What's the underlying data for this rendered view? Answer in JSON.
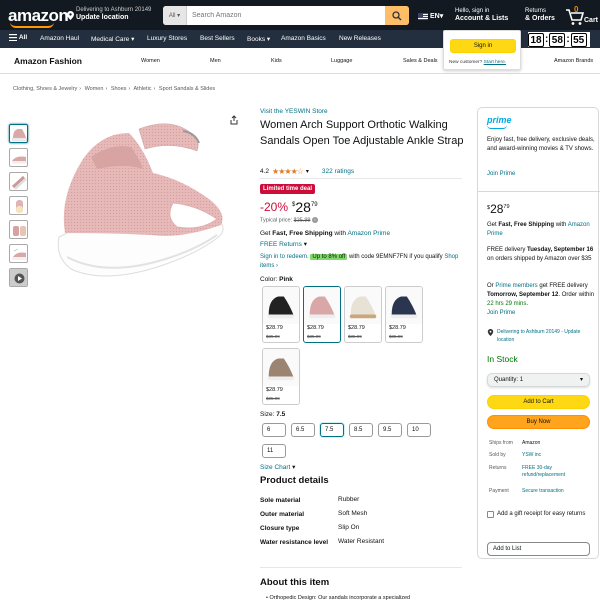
{
  "nav": {
    "logo": "amazon",
    "deliver_line1": "Delivering to Ashburn 20149",
    "deliver_line2": "Update location",
    "search_category": "All",
    "search_placeholder": "Search Amazon",
    "language": "EN",
    "account_line1": "Hello, sign in",
    "account_line2": "Account & Lists",
    "returns_line1": "Returns",
    "returns_line2": "& Orders",
    "cart_count": "0",
    "cart_label": "Cart"
  },
  "subnav": {
    "all_label": "All",
    "items": [
      "Amazon Haul",
      "Medical Care",
      "Luxury Stores",
      "Best Sellers",
      "Books",
      "Amazon Basics",
      "New Releases"
    ]
  },
  "popover": {
    "signin": "Sign in",
    "new_customer": "New customer?",
    "start_here": "Start here."
  },
  "countdown": {
    "h": "18",
    "m": "58",
    "s": "55"
  },
  "fashion": {
    "title": "Amazon Fashion",
    "categories": [
      "Women",
      "Men",
      "Kids",
      "Luggage",
      "Sales & Deals",
      "Amazon Brands"
    ]
  },
  "breadcrumb": [
    "Clothing, Shoes & Jewelry",
    "Women",
    "Shoes",
    "Athletic",
    "Sport Sandals & Slides"
  ],
  "product": {
    "store_link": "Visit the YESWIN Store",
    "title": "Women Arch Support Orthotic Walking Sandals Open Toe Adjustable Ankle Strap",
    "rating": "4.2",
    "rating_stars": 4.2,
    "ratings_count": "322 ratings",
    "deal_badge": "Limited time deal",
    "discount": "-20%",
    "currency": "$",
    "price_whole": "28",
    "price_fraction": "79",
    "typical_label": "Typical price:",
    "typical_price": "$35.99",
    "fast_free_prefix": "Get",
    "fast_free_bold": "Fast, Free Shipping",
    "fast_free_with": "with",
    "fast_free_link": "Amazon Prime",
    "free_returns": "FREE Returns",
    "redeem_prefix": "Sign in to redeem.",
    "redeem_pill": "Up to 8% off",
    "redeem_suffix": "with code 9EMNF7FN if you qualify",
    "shop_items": "Shop items ›",
    "color_label": "Color:",
    "color_value": "Pink",
    "swatches": [
      {
        "name": "Black",
        "price": "$28.79",
        "old": "$35.99"
      },
      {
        "name": "Pink",
        "price": "$28.79",
        "old": "$35.99"
      },
      {
        "name": "Beige",
        "price": "$28.79",
        "old": "$35.99"
      },
      {
        "name": "Navy",
        "price": "$28.79",
        "old": "$35.99"
      },
      {
        "name": "Brown",
        "price": "$28.79",
        "old": "$35.99"
      }
    ],
    "size_label": "Size:",
    "size_value": "7.5",
    "sizes": [
      "6",
      "6.5",
      "7.5",
      "8.5",
      "9.5",
      "10",
      "11"
    ],
    "size_chart": "Size Chart",
    "details_title": "Product details",
    "details": [
      {
        "k": "Sole material",
        "v": "Rubber"
      },
      {
        "k": "Outer material",
        "v": "Soft Mesh"
      },
      {
        "k": "Closure type",
        "v": "Slip On"
      },
      {
        "k": "Water resistance level",
        "v": "Water Resistant"
      }
    ],
    "about_title": "About this item",
    "about_first": "Orthopedic Design: Our sandals incorporate a specialized"
  },
  "buybox": {
    "prime_logo": "prime",
    "prime_text": "Enjoy fast, free delivery, exclusive deals, and award-winning movies & TV shows.",
    "join_prime": "Join Prime",
    "currency": "$",
    "price_whole": "28",
    "price_fraction": "79",
    "ff_prefix": "Get",
    "ff_bold": "Fast, Free Shipping",
    "ff_with": "with",
    "ff_link": "Amazon Prime",
    "delivery_prefix": "FREE delivery",
    "delivery_date": "Tuesday, September 16",
    "delivery_suffix": "on orders shipped by Amazon over $35",
    "fast_or": "Or",
    "fast_link": "Prime members",
    "fast_mid": "get FREE delivery",
    "fast_date": "Tomorrow, September 12",
    "fast_order": ". Order within",
    "fast_time": "22 hrs 29 mins",
    "fast_end": ".",
    "join_prime2": "Join Prime",
    "location": "Delivering to Ashburn 20149 - Update location",
    "stock": "In Stock",
    "qty_label": "Quantity:",
    "qty_value": "1",
    "add_to_cart": "Add to Cart",
    "buy_now": "Buy Now",
    "info": [
      {
        "k": "Ships from",
        "v": "Amazon"
      },
      {
        "k": "Sold by",
        "v": "YSW inc"
      },
      {
        "k": "Returns",
        "v": "FREE 30-day refund/replacement"
      },
      {
        "k": "Payment",
        "v": "Secure transaction"
      }
    ],
    "gift": "Add a gift receipt for easy returns",
    "add_list": "Add to List"
  },
  "colors": {
    "nav": "#131921",
    "subnav": "#232f3e",
    "accent": "#ff9900",
    "deal": "#cc0c39",
    "link": "#007185",
    "stock": "#007600",
    "cart_btn": "#ffd814",
    "buy_btn": "#ffa41c"
  }
}
